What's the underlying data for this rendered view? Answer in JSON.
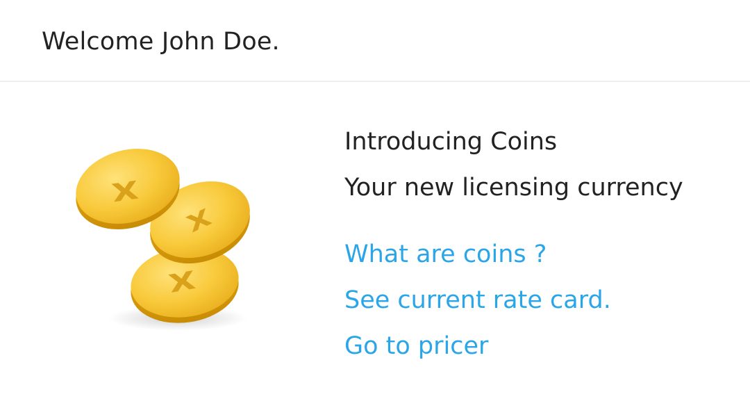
{
  "header": {
    "welcome_text": "Welcome John Doe."
  },
  "promo": {
    "title": "Introducing Coins",
    "subtitle": "Your new licensing currency",
    "links": [
      {
        "label": "What are coins ?"
      },
      {
        "label": "See current rate card."
      },
      {
        "label": "Go to pricer"
      }
    ],
    "illustration_icon": "gold-coins-icon"
  },
  "colors": {
    "link": "#2aa6e8",
    "text": "#222222",
    "coin_gold": "#f5c12e",
    "divider": "#eeeeee"
  }
}
